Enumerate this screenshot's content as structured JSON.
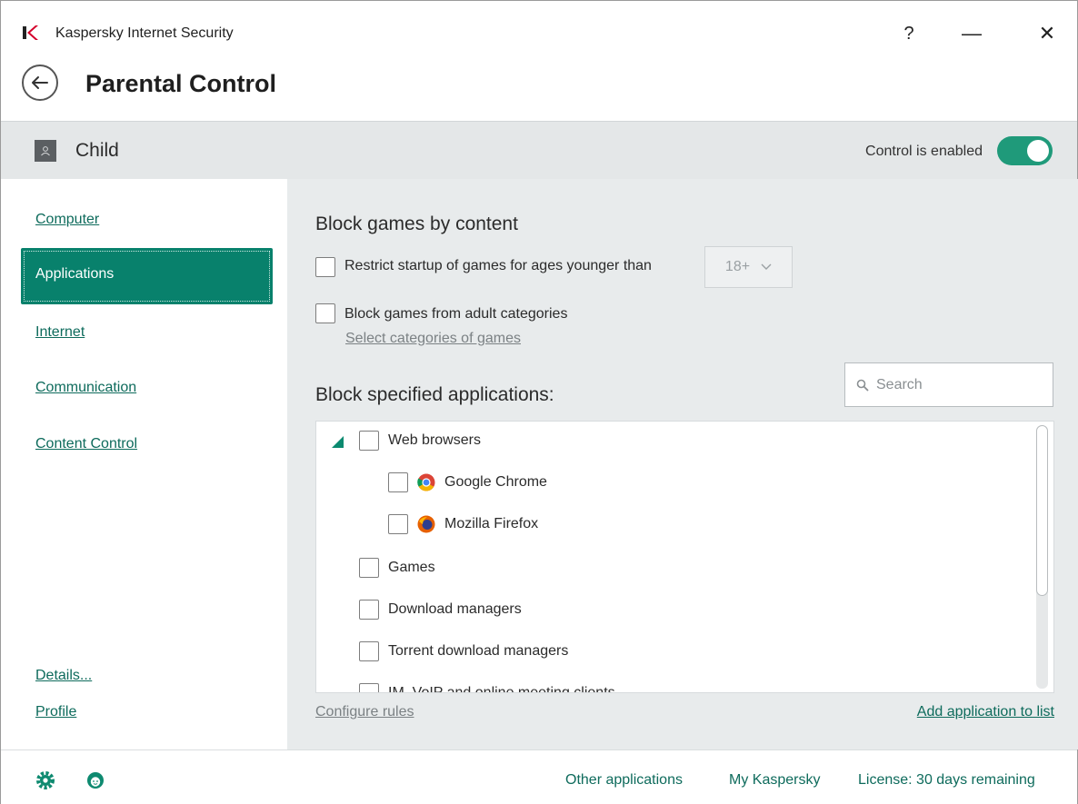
{
  "window": {
    "title": "Kaspersky Internet Security",
    "help_label": "?",
    "minimize_label": "—",
    "close_label": "✕"
  },
  "header": {
    "page_title": "Parental Control",
    "back_icon": "arrow-left-icon"
  },
  "profile": {
    "name": "Child",
    "control_label": "Control is enabled",
    "control_enabled": true,
    "accent_color": "#1f9a7a"
  },
  "sidebar": {
    "items": [
      {
        "label": "Computer",
        "active": false
      },
      {
        "label": "Applications",
        "active": true
      },
      {
        "label": "Internet",
        "active": false
      },
      {
        "label": "Communication",
        "active": false
      },
      {
        "label": "Content Control",
        "active": false
      }
    ],
    "details_label": "Details...",
    "profile_label": "Profile",
    "active_color": "#08816c"
  },
  "main": {
    "block_games_title": "Block games by content",
    "restrict_label": "Restrict startup of games for ages younger than",
    "age_value": "18+",
    "adult_label": "Block games from adult categories",
    "select_categories_label": "Select categories of games",
    "block_apps_title": "Block specified applications:",
    "search_placeholder": "Search",
    "app_list": [
      {
        "label": "Web browsers",
        "level": 0,
        "expanded": true
      },
      {
        "label": "Google Chrome",
        "level": 1,
        "icon": "chrome-icon"
      },
      {
        "label": "Mozilla Firefox",
        "level": 1,
        "icon": "firefox-icon"
      },
      {
        "label": "Games",
        "level": 0
      },
      {
        "label": "Download managers",
        "level": 0
      },
      {
        "label": "Torrent download managers",
        "level": 0
      },
      {
        "label": "IM, VoIP and online meeting clients",
        "level": 0
      }
    ],
    "configure_rules_label": "Configure rules",
    "add_app_label": "Add application to list"
  },
  "footer": {
    "other_apps_label": "Other applications",
    "my_kaspersky_label": "My Kaspersky",
    "license_label": "License: 30 days remaining",
    "settings_icon": "gear-icon",
    "support_icon": "support-face-icon"
  }
}
